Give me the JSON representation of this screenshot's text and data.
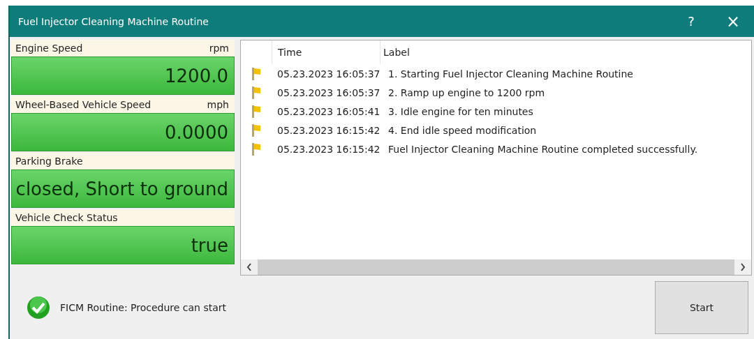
{
  "window": {
    "title": "Fuel Injector Cleaning Machine Routine",
    "help": "?",
    "close": "×"
  },
  "gauges": [
    {
      "label": "Engine Speed",
      "unit": "rpm",
      "value": "1200.0"
    },
    {
      "label": "Wheel-Based Vehicle Speed",
      "unit": "mph",
      "value": "0.0000"
    },
    {
      "label": "Parking Brake",
      "value": "closed, Short to ground"
    },
    {
      "label": "Vehicle Check Status",
      "value": "true"
    }
  ],
  "log": {
    "columns": [
      "Time",
      "Label"
    ],
    "rows": [
      {
        "time": "05.23.2023 16:05:37",
        "label": "1. Starting Fuel Injector Cleaning Machine Routine"
      },
      {
        "time": "05.23.2023 16:05:37",
        "label": "2. Ramp up engine to 1200 rpm"
      },
      {
        "time": "05.23.2023 16:05:41",
        "label": "3. Idle engine for ten minutes"
      },
      {
        "time": "05.23.2023 16:15:42",
        "label": "4. End idle speed modification"
      },
      {
        "time": "05.23.2023 16:15:42",
        "label": "Fuel Injector Cleaning Machine Routine completed successfully."
      }
    ]
  },
  "status": {
    "kind": "ok",
    "message": "FICM Routine: Procedure can start"
  },
  "buttons": [
    "Start"
  ]
}
